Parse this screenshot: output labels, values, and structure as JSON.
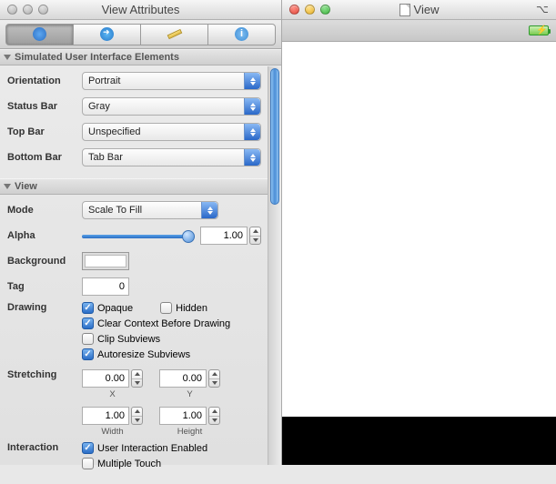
{
  "leftWindow": {
    "title": "View Attributes"
  },
  "rightWindow": {
    "title": "View"
  },
  "sections": {
    "simUI": "Simulated User Interface Elements",
    "view": "View"
  },
  "simUI": {
    "orientation": {
      "label": "Orientation",
      "value": "Portrait"
    },
    "statusBar": {
      "label": "Status Bar",
      "value": "Gray"
    },
    "topBar": {
      "label": "Top Bar",
      "value": "Unspecified"
    },
    "bottomBar": {
      "label": "Bottom Bar",
      "value": "Tab Bar"
    }
  },
  "view": {
    "mode": {
      "label": "Mode",
      "value": "Scale To Fill"
    },
    "alpha": {
      "label": "Alpha",
      "value": "1.00"
    },
    "background": {
      "label": "Background"
    },
    "tag": {
      "label": "Tag",
      "value": "0"
    },
    "drawing": {
      "label": "Drawing",
      "opaque": {
        "label": "Opaque",
        "checked": true
      },
      "hidden": {
        "label": "Hidden",
        "checked": false
      },
      "clearCtx": {
        "label": "Clear Context Before Drawing",
        "checked": true
      },
      "clipSub": {
        "label": "Clip Subviews",
        "checked": false
      },
      "autoresize": {
        "label": "Autoresize Subviews",
        "checked": true
      }
    },
    "stretching": {
      "label": "Stretching",
      "x": {
        "value": "0.00",
        "label": "X"
      },
      "y": {
        "value": "0.00",
        "label": "Y"
      },
      "width": {
        "value": "1.00",
        "label": "Width"
      },
      "height": {
        "value": "1.00",
        "label": "Height"
      }
    },
    "interaction": {
      "label": "Interaction",
      "userInt": {
        "label": "User Interaction Enabled",
        "checked": true
      },
      "multiTch": {
        "label": "Multiple Touch",
        "checked": false
      }
    }
  }
}
